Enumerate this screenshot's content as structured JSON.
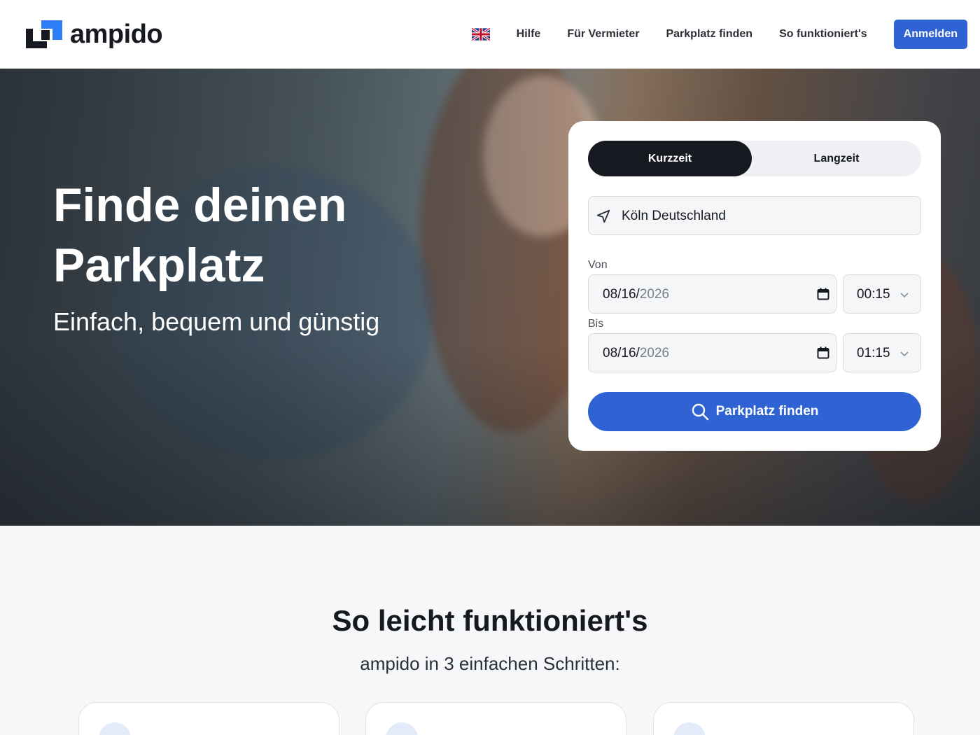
{
  "header": {
    "logo_text": "ampido",
    "nav": [
      "Hilfe",
      "Für Vermieter",
      "Parkplatz finden",
      "So funktioniert's"
    ],
    "login_label": "Anmelden",
    "language_icon": "uk-flag-icon"
  },
  "hero": {
    "title": "Finde deinen Parkplatz",
    "subtitle": "Einfach, bequem und günstig"
  },
  "search": {
    "tabs": [
      "Kurzzeit",
      "Langzeit"
    ],
    "active_tab": "Kurzzeit",
    "location": "Köln Deutschland",
    "from_label": "Von",
    "from_date_md": "08/16/",
    "from_date_year": "2026",
    "from_time": "00:15",
    "to_label": "Bis",
    "to_date_md": "08/16/",
    "to_date_year": "2026",
    "to_time": "01:15",
    "submit_label": "Parkplatz finden"
  },
  "section": {
    "title": "So leicht funktioniert's",
    "subtitle": "ampido in 3 einfachen Schritten:"
  },
  "colors": {
    "primary": "#2f63d3",
    "dark": "#16191f",
    "background": "#f6f7f9"
  }
}
